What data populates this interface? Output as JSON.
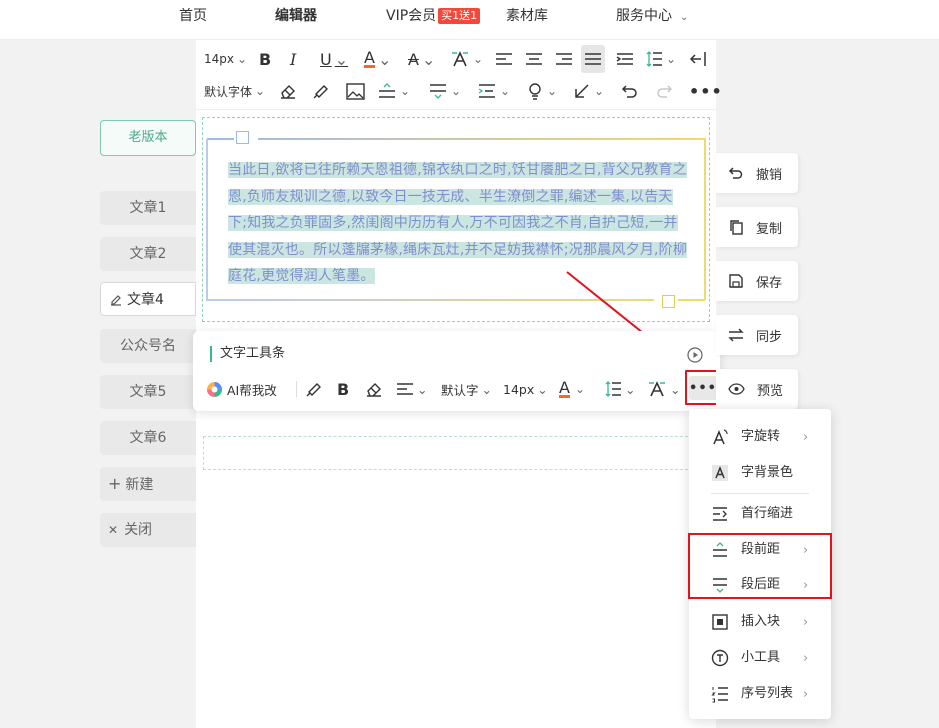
{
  "nav": {
    "items": [
      "首页",
      "编辑器",
      "VIP会员",
      "素材库",
      "服务中心"
    ],
    "vip_badge": "买1送1"
  },
  "sidebar": {
    "old_version": "老版本",
    "articles": [
      "文章1",
      "文章2",
      "文章4",
      "公众号名",
      "文章5",
      "文章6"
    ],
    "new_label": "新建",
    "close_label": "关闭"
  },
  "toolbar": {
    "font_size": "14px",
    "font_family": "默认字体"
  },
  "content": {
    "text": "当此日,欲将已往所赖天恩祖德,锦衣纨口之时,饫甘餍肥之日,背父兄教育之恩,负师友规训之德,以致今日一技无成、半生潦倒之罪,编述一集,以告天下;知我之负罪固多,然闺阁中历历有人,万不可因我之不肖,自护己短,一并使其混灭也。所以蓬牖茅椽,绳床瓦灶,并不足妨我襟怀;况那晨风夕月,阶柳庭花,更觉得润人笔墨。"
  },
  "text_toolbar": {
    "title": "文字工具条",
    "ai_label": "AI帮我改",
    "font_family": "默认字",
    "font_size": "14px"
  },
  "right_panel": {
    "undo": "撤销",
    "copy": "复制",
    "save": "保存",
    "sync": "同步",
    "preview": "预览"
  },
  "more_menu": {
    "items": [
      {
        "label": "字旋转",
        "icon": "rotate-text-icon",
        "arrow": true
      },
      {
        "label": "字背景色",
        "icon": "text-background-icon",
        "arrow": false
      },
      {
        "label": "首行缩进",
        "icon": "first-line-indent-icon",
        "arrow": false
      },
      {
        "label": "段前距",
        "icon": "space-before-icon",
        "arrow": true
      },
      {
        "label": "段后距",
        "icon": "space-after-icon",
        "arrow": true
      },
      {
        "label": "插入块",
        "icon": "insert-block-icon",
        "arrow": true
      },
      {
        "label": "小工具",
        "icon": "tools-icon",
        "arrow": true
      },
      {
        "label": "序号列表",
        "icon": "numbered-list-icon",
        "arrow": true
      }
    ]
  },
  "colors": {
    "accent_green": "#39b88e",
    "highlight_red": "#e0141e",
    "text_blue": "#7f8fcf",
    "selection_bg": "#cbe6e0"
  }
}
